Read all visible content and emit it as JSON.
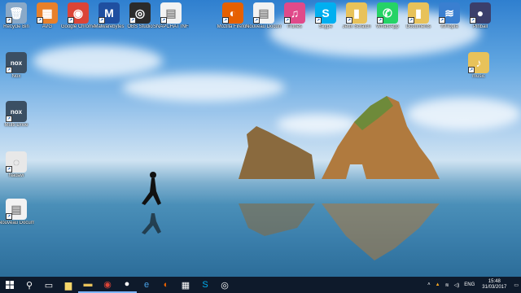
{
  "desktop": {
    "top_icons": [
      {
        "label": "Recycle Bin",
        "icon": "recycle-bin-icon",
        "color": "#8aa9c8",
        "glyph": "🗑"
      },
      {
        "label": "AVG",
        "icon": "avg-icon",
        "color": "#e8802a",
        "glyph": "▦"
      },
      {
        "label": "Google Chrome",
        "icon": "chrome-icon",
        "color": "#db4437",
        "glyph": "◉"
      },
      {
        "label": "Malwarebytes",
        "icon": "malwarebytes-icon",
        "color": "#1f4fa0",
        "glyph": "M"
      },
      {
        "label": "OBS Studio",
        "icon": "obs-icon",
        "color": "#2b2b2b",
        "glyph": "◎"
      },
      {
        "label": "SNAPCHAT INFO",
        "icon": "document-icon",
        "color": "#f2f2f2",
        "glyph": "▤"
      },
      {
        "label": "Mozilla Firefox",
        "icon": "firefox-icon",
        "color": "#e66000",
        "glyph": "◐"
      },
      {
        "label": "Nouveau Docum",
        "icon": "document-icon",
        "color": "#f2f2f2",
        "glyph": "▤"
      },
      {
        "label": "iTunes",
        "icon": "itunes-icon",
        "color": "#e04a8a",
        "glyph": "♫"
      },
      {
        "label": "Skype",
        "icon": "skype-icon",
        "color": "#00aff0",
        "glyph": "S"
      },
      {
        "label": "Jeux Scratch",
        "icon": "folder-icon",
        "color": "#e8c25a",
        "glyph": "▮"
      },
      {
        "label": "WhatsApp",
        "icon": "whatsapp-icon",
        "color": "#25d366",
        "glyph": "✆"
      },
      {
        "label": "Documents",
        "icon": "folder-icon",
        "color": "#e8c25a",
        "glyph": "▮"
      },
      {
        "label": "WiTopia",
        "icon": "wifi-icon",
        "color": "#3a7fd0",
        "glyph": "≋"
      },
      {
        "label": "Pinball",
        "icon": "pinball-icon",
        "color": "#3b3f6b",
        "glyph": "●"
      }
    ],
    "left_icons": [
      {
        "label": "Nox",
        "icon": "nox-icon",
        "color": "#3b4f63",
        "glyph": "nox"
      },
      {
        "label": "Multi-Drive",
        "icon": "nox-icon",
        "color": "#3b4f63",
        "glyph": "nox"
      },
      {
        "label": "Nadavi",
        "icon": "app-icon",
        "color": "#e8e8e8",
        "glyph": "◌"
      },
      {
        "label": "Nouveau Docum",
        "icon": "document-icon",
        "color": "#f2f2f2",
        "glyph": "▤"
      }
    ],
    "right_icons": [
      {
        "label": "music",
        "icon": "music-folder-icon",
        "color": "#e8c25a",
        "glyph": "♪"
      }
    ]
  },
  "taskbar": {
    "start_icon": "windows-start-icon",
    "items": [
      {
        "name": "search-icon",
        "glyph": "⚲"
      },
      {
        "name": "task-view-icon",
        "glyph": "▭"
      },
      {
        "name": "sticky-notes-icon",
        "glyph": "▆",
        "color": "#f5d66a"
      },
      {
        "name": "file-explorer-icon",
        "glyph": "▬",
        "color": "#e8c25a"
      },
      {
        "name": "chrome-icon",
        "glyph": "◉",
        "color": "#db4437"
      },
      {
        "name": "app-icon",
        "glyph": "●",
        "color": "#ffffff"
      },
      {
        "name": "edge-icon",
        "glyph": "e",
        "color": "#4aa3e8"
      },
      {
        "name": "firefox-icon",
        "glyph": "◐",
        "color": "#e66000"
      },
      {
        "name": "calculator-icon",
        "glyph": "▦",
        "color": "#ffffff"
      },
      {
        "name": "skype-icon",
        "glyph": "S",
        "color": "#00aff0"
      },
      {
        "name": "obs-icon",
        "glyph": "◎",
        "color": "#ffffff"
      }
    ],
    "tray": {
      "language": "ENG",
      "time": "15:48",
      "date": "31/03/2017"
    }
  }
}
